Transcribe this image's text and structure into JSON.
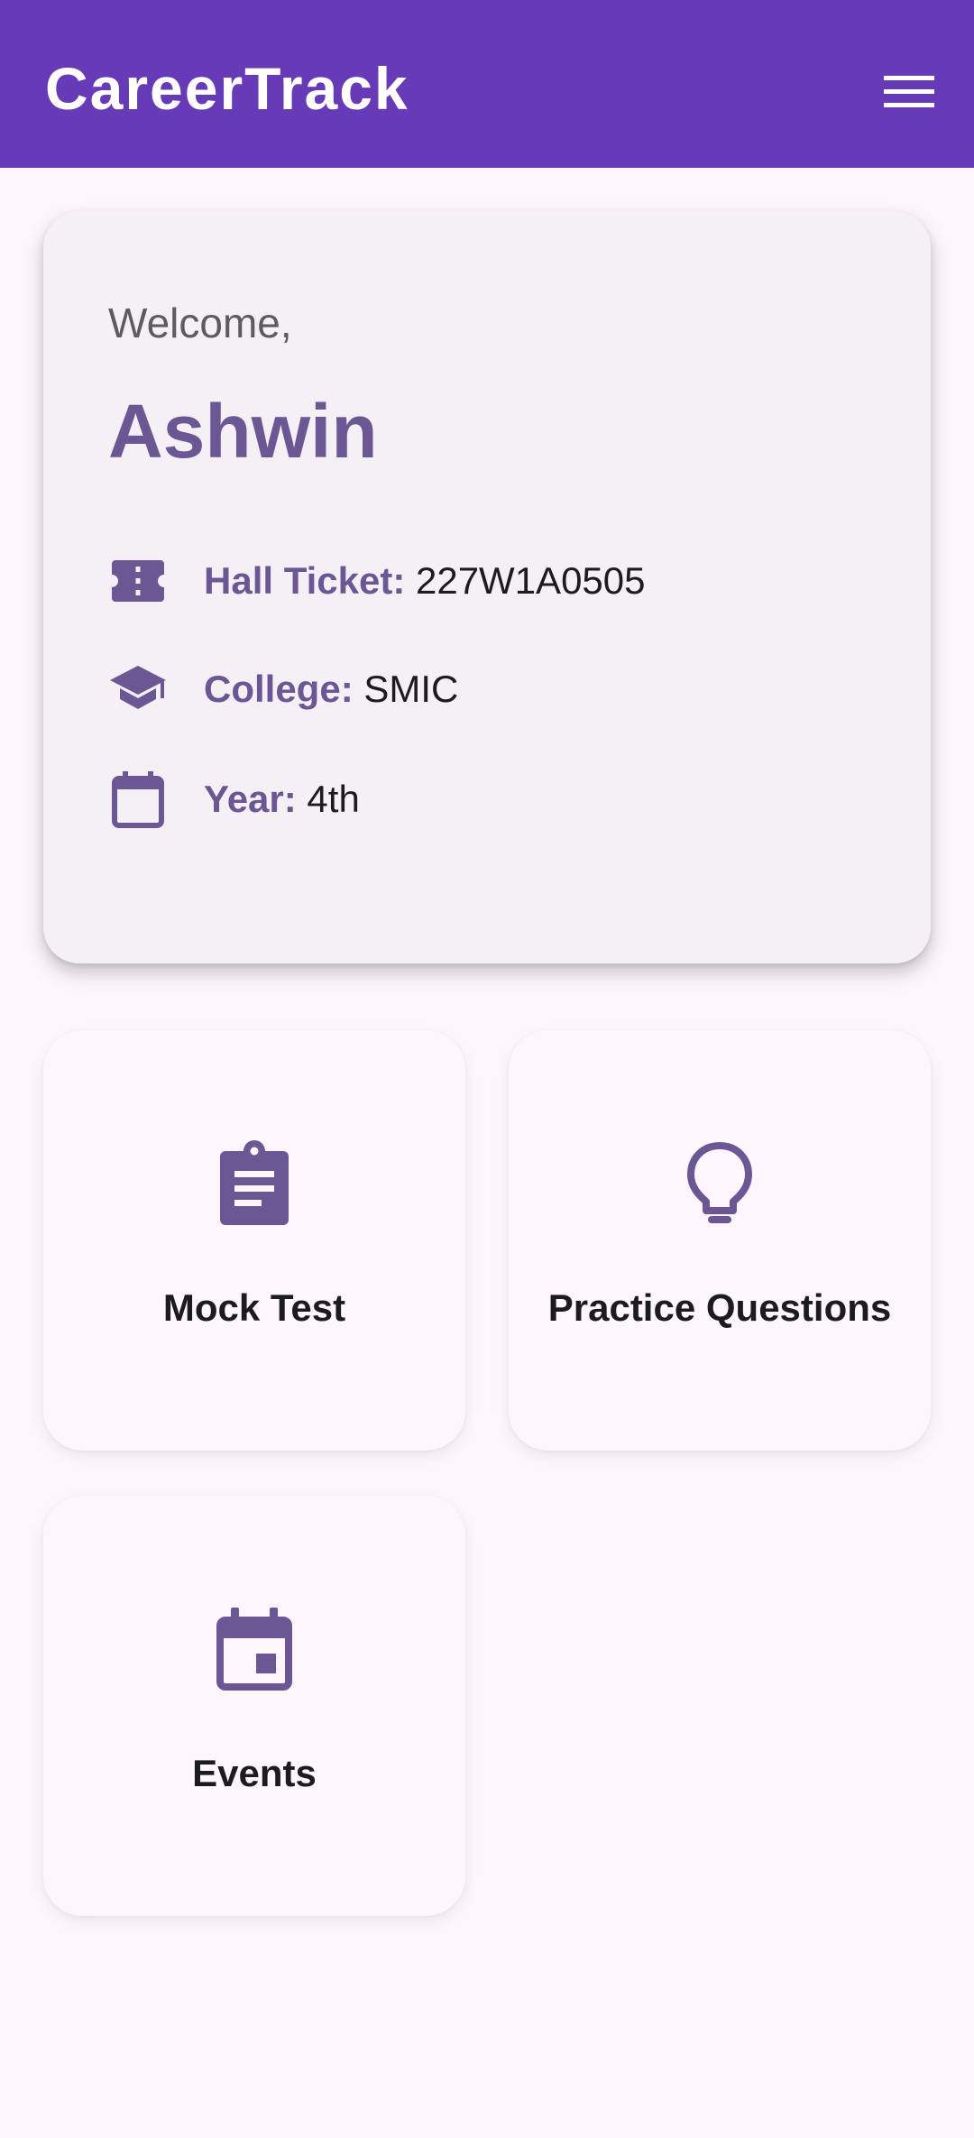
{
  "app_bar": {
    "title": "CareerTrack",
    "menu_icon": "hamburger-menu-icon",
    "background_color": "#673AB7"
  },
  "profile_card": {
    "greeting": "Welcome,",
    "name": "Ashwin",
    "accent_color": "#6A5794",
    "details": [
      {
        "icon": "ticket-icon",
        "label": "Hall Ticket:",
        "value": " 227W1A0505"
      },
      {
        "icon": "graduation-cap-icon",
        "label": "College:",
        "value": " SMIC"
      },
      {
        "icon": "calendar-icon",
        "label": "Year:",
        "value": " 4th"
      }
    ]
  },
  "tiles": [
    {
      "icon": "clipboard-icon",
      "label": "Mock Test"
    },
    {
      "icon": "lightbulb-icon",
      "label": "Practice Questions"
    },
    {
      "icon": "event-calendar-icon",
      "label": "Events"
    }
  ]
}
